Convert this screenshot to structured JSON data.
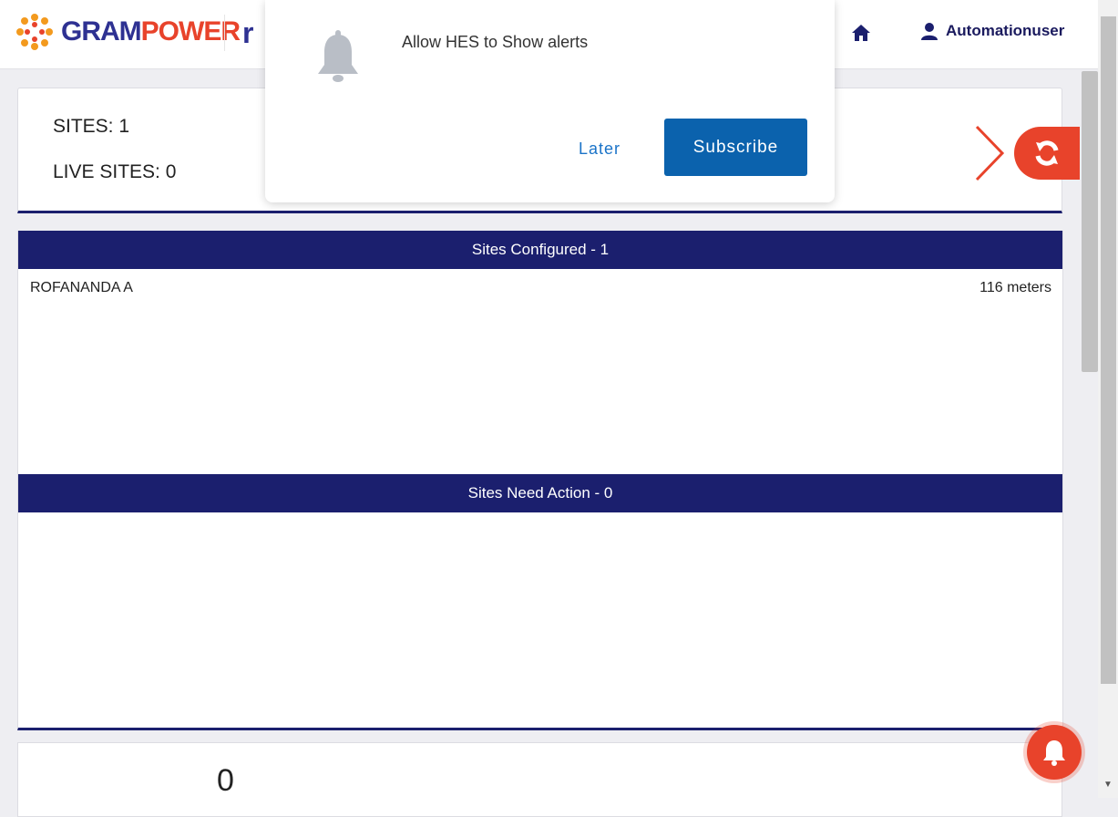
{
  "header": {
    "logo_text_gram": "GRAM",
    "logo_text_power": "POWER",
    "secondary_logo_fragment": "r",
    "home_icon": "home-icon",
    "user_icon": "user-icon",
    "user_name": "Automationuser"
  },
  "summary": {
    "sites_label": "SITES: 1",
    "live_sites_label": "LIVE SITES: 0",
    "chevron_icon": "chevron-right-icon"
  },
  "refresh": {
    "icon": "refresh-icon"
  },
  "sites_configured": {
    "header": "Sites Configured - 1",
    "rows": [
      {
        "name": "ROFANANDA A",
        "meters": "116 meters"
      }
    ]
  },
  "sites_need_action": {
    "header": "Sites Need Action - 0",
    "rows": []
  },
  "bottom_card": {
    "value": "0"
  },
  "notification_popup": {
    "icon": "bell-icon",
    "message": "Allow HES to Show alerts",
    "later_label": "Later",
    "subscribe_label": "Subscribe"
  },
  "floating_bell": {
    "icon": "bell-icon"
  },
  "colors": {
    "brand_navy": "#1b1f6e",
    "brand_orange": "#e8432b",
    "subscribe_blue": "#0b62ad",
    "link_blue": "#1a73c8"
  }
}
